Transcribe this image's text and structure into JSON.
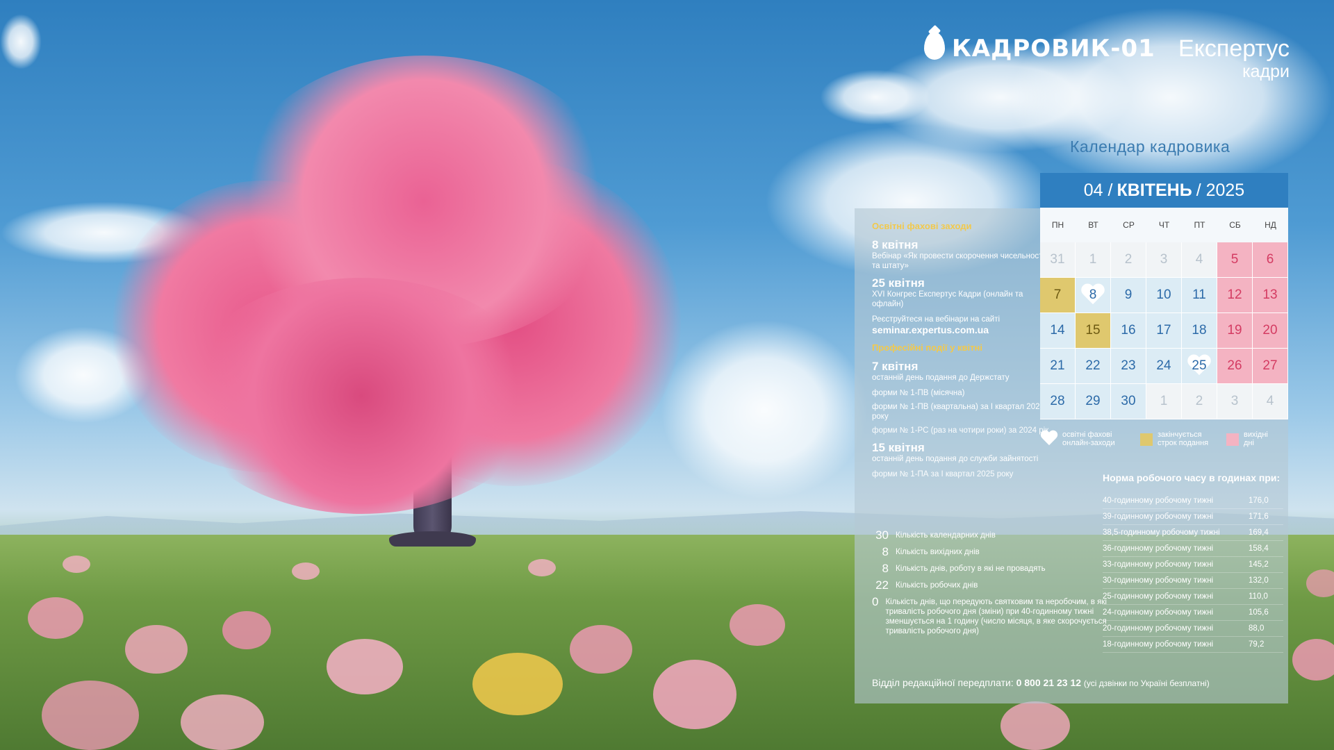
{
  "header": {
    "logo_text": "КАДРОВИК-01",
    "brand_line1": "Експертус",
    "brand_line2": "кадри",
    "calendar_title": "Календар кадровика"
  },
  "calendar": {
    "month_num": "04 /",
    "month_name": "КВІТЕНЬ",
    "year": "/ 2025",
    "weekdays": [
      "ПН",
      "ВТ",
      "СР",
      "ЧТ",
      "ПТ",
      "СБ",
      "НД"
    ],
    "days": [
      {
        "d": "31",
        "type": "other"
      },
      {
        "d": "1",
        "type": "other"
      },
      {
        "d": "2",
        "type": "other"
      },
      {
        "d": "3",
        "type": "other"
      },
      {
        "d": "4",
        "type": "other"
      },
      {
        "d": "5",
        "type": "weekend"
      },
      {
        "d": "6",
        "type": "weekend"
      },
      {
        "d": "7",
        "type": "deadline"
      },
      {
        "d": "8",
        "type": "event"
      },
      {
        "d": "9",
        "type": "work"
      },
      {
        "d": "10",
        "type": "work"
      },
      {
        "d": "11",
        "type": "work"
      },
      {
        "d": "12",
        "type": "weekend"
      },
      {
        "d": "13",
        "type": "weekend"
      },
      {
        "d": "14",
        "type": "work"
      },
      {
        "d": "15",
        "type": "deadline"
      },
      {
        "d": "16",
        "type": "work"
      },
      {
        "d": "17",
        "type": "work"
      },
      {
        "d": "18",
        "type": "work"
      },
      {
        "d": "19",
        "type": "weekend"
      },
      {
        "d": "20",
        "type": "weekend"
      },
      {
        "d": "21",
        "type": "work"
      },
      {
        "d": "22",
        "type": "work"
      },
      {
        "d": "23",
        "type": "work"
      },
      {
        "d": "24",
        "type": "work"
      },
      {
        "d": "25",
        "type": "event"
      },
      {
        "d": "26",
        "type": "weekend"
      },
      {
        "d": "27",
        "type": "weekend"
      },
      {
        "d": "28",
        "type": "work"
      },
      {
        "d": "29",
        "type": "work"
      },
      {
        "d": "30",
        "type": "work"
      },
      {
        "d": "1",
        "type": "other"
      },
      {
        "d": "2",
        "type": "other"
      },
      {
        "d": "3",
        "type": "other"
      },
      {
        "d": "4",
        "type": "other"
      }
    ],
    "legend": {
      "events": "освітні фахові онлайн-заходи",
      "deadline": "закінчується строк подання",
      "weekend": "вихідні дні"
    }
  },
  "events_section": {
    "title": "Освітні фахові заходи",
    "items": [
      {
        "date": "8 квітня",
        "desc": "Вебінар «Як провести скорочення чисельності та штату»"
      },
      {
        "date": "25 квітня",
        "desc": "XVI Конгрес Експертус Кадри (онлайн та офлайн)"
      }
    ],
    "register_text": "Реєструйтеся на вебінари на сайті",
    "register_link": "seminar.expertus.com.ua"
  },
  "deadlines_section": {
    "title": "Професійні події у квітні",
    "items": [
      {
        "date": "7 квітня",
        "desc": "останній день подання до Держстату",
        "forms": [
          "форми № 1-ПВ (місячна)",
          "форми № 1-ПВ (квартальна) за І квартал 2025 року",
          "форми № 1-РС (раз на чотири роки) за 2024 рік"
        ]
      },
      {
        "date": "15 квітня",
        "desc": "останній день подання до служби зайнятості",
        "forms": [
          "форми № 1-ПА за І квартал 2025 року"
        ]
      }
    ]
  },
  "stats": [
    {
      "n": "30",
      "t": "Кількість календарних днів"
    },
    {
      "n": "8",
      "t": "Кількість вихідних днів"
    },
    {
      "n": "8",
      "t": "Кількість днів, роботу в які не провадять"
    },
    {
      "n": "22",
      "t": "Кількість робочих днів"
    },
    {
      "n": "0",
      "t": "Кількість днів, що передують святковим та неробочим, в які тривалість робочого дня (зміни) при 40-годинному тижні зменшується на 1 годину (число місяця, в яке скорочується тривалість робочого дня)"
    }
  ],
  "norm": {
    "title": "Норма робочого часу в годинах при:",
    "rows": [
      {
        "label": "40-годинному робочому тижні",
        "value": "176,0"
      },
      {
        "label": "39-годинному робочому тижні",
        "value": "171,6"
      },
      {
        "label": "38,5-годинному робочому тижні",
        "value": "169,4"
      },
      {
        "label": "36-годинному робочому тижні",
        "value": "158,4"
      },
      {
        "label": "33-годинному робочому тижні",
        "value": "145,2"
      },
      {
        "label": "30-годинному робочому тижні",
        "value": "132,0"
      },
      {
        "label": "25-годинному робочому тижні",
        "value": "110,0"
      },
      {
        "label": "24-годинному робочому тижні",
        "value": "105,6"
      },
      {
        "label": "20-годинному робочому тижні",
        "value": "88,0"
      },
      {
        "label": "18-годинному робочому тижні",
        "value": "79,2"
      }
    ]
  },
  "footer": {
    "label": "Відділ редакційної передплати:",
    "phone": "0 800 21 23 12",
    "note": "(усі дзвінки по Україні безплатні)"
  },
  "colors": {
    "header_blue": "#2f7fc0",
    "weekend_pink": "#f4b3c2",
    "deadline_yellow": "#dfc86e",
    "section_title_yellow": "#f2c94c"
  }
}
